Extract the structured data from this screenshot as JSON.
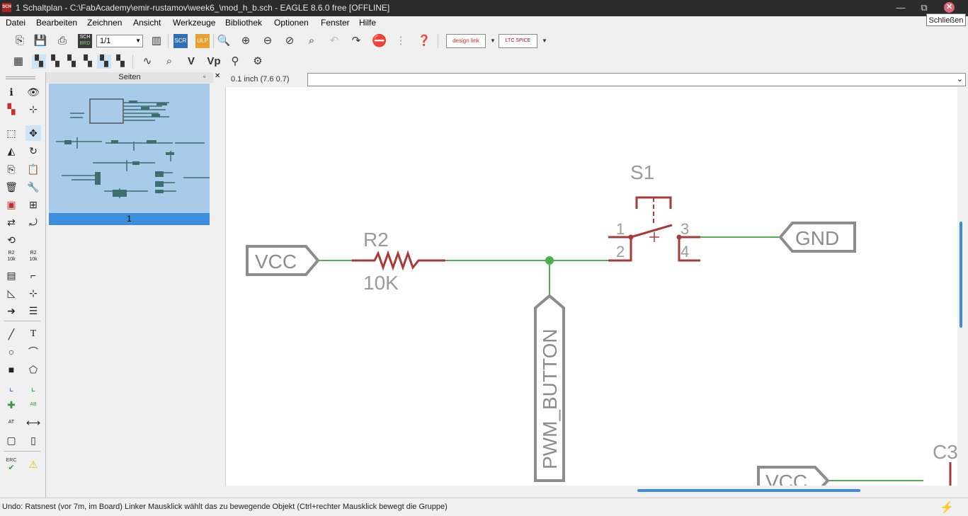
{
  "window": {
    "title": "1 Schaltplan - C:\\FabAcademy\\emir-rustamov\\week6_\\mod_h_b.sch - EAGLE 8.6.0 free [OFFLINE]",
    "app_icon_text": "SCH",
    "close_tooltip": "Schließen"
  },
  "menu": [
    "Datei",
    "Bearbeiten",
    "Zeichnen",
    "Ansicht",
    "Werkzeuge",
    "Bibliothek",
    "Optionen",
    "Fenster",
    "Hilfe"
  ],
  "toolbar": {
    "page_select": "1/1",
    "scr_label": "SCR",
    "brd_label": "BRD",
    "ulp_label": "ULP",
    "designlink_label": "design link",
    "ltspice_label": "LTC SPICE"
  },
  "toolbar2": {
    "v_label": "V",
    "vp_label": "Vp"
  },
  "leftbar": {
    "r2_label": "R2",
    "r2_val": "10k",
    "r2_label2": "R2",
    "r2_val2": "10k",
    "erc_label": "ERC",
    "ab_label": "AB",
    "at_label": "AT"
  },
  "pages_panel": {
    "title": "Seiten",
    "page_number": "1"
  },
  "coordinate": "0.1 inch (7.6 0.7)",
  "command_line": "",
  "schematic": {
    "vcc_label": "VCC",
    "r2_name": "R2",
    "r2_value": "10K",
    "s1_name": "S1",
    "pin1": "1",
    "pin2": "2",
    "pin3": "3",
    "pin4": "4",
    "gnd_label": "GND",
    "pwm_label": "PWM_BUTTON",
    "c3_label": "C3",
    "vcc2_label": "VCC",
    "colors": {
      "net": "#4caf50",
      "symbol": "#a83a3a",
      "label": "#8c8c8c",
      "text": "#9a9a9a"
    }
  },
  "status": {
    "text": "Undo: Ratsnest (vor 7m, im Board) Linker Mausklick wählt das zu bewegende Objekt (Ctrl+rechter Mausklick bewegt die Gruppe)"
  }
}
